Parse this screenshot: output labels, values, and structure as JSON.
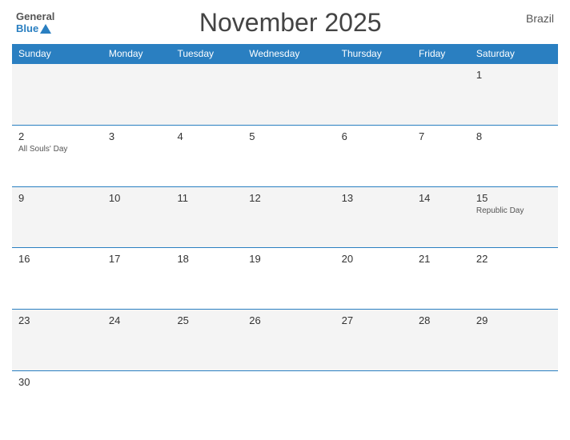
{
  "logo": {
    "general": "General",
    "blue": "Blue"
  },
  "title": "November 2025",
  "country": "Brazil",
  "days_header": [
    "Sunday",
    "Monday",
    "Tuesday",
    "Wednesday",
    "Thursday",
    "Friday",
    "Saturday"
  ],
  "weeks": [
    [
      {
        "day": "",
        "holiday": ""
      },
      {
        "day": "",
        "holiday": ""
      },
      {
        "day": "",
        "holiday": ""
      },
      {
        "day": "",
        "holiday": ""
      },
      {
        "day": "",
        "holiday": ""
      },
      {
        "day": "",
        "holiday": ""
      },
      {
        "day": "1",
        "holiday": ""
      }
    ],
    [
      {
        "day": "2",
        "holiday": "All Souls' Day"
      },
      {
        "day": "3",
        "holiday": ""
      },
      {
        "day": "4",
        "holiday": ""
      },
      {
        "day": "5",
        "holiday": ""
      },
      {
        "day": "6",
        "holiday": ""
      },
      {
        "day": "7",
        "holiday": ""
      },
      {
        "day": "8",
        "holiday": ""
      }
    ],
    [
      {
        "day": "9",
        "holiday": ""
      },
      {
        "day": "10",
        "holiday": ""
      },
      {
        "day": "11",
        "holiday": ""
      },
      {
        "day": "12",
        "holiday": ""
      },
      {
        "day": "13",
        "holiday": ""
      },
      {
        "day": "14",
        "holiday": ""
      },
      {
        "day": "15",
        "holiday": "Republic Day"
      }
    ],
    [
      {
        "day": "16",
        "holiday": ""
      },
      {
        "day": "17",
        "holiday": ""
      },
      {
        "day": "18",
        "holiday": ""
      },
      {
        "day": "19",
        "holiday": ""
      },
      {
        "day": "20",
        "holiday": ""
      },
      {
        "day": "21",
        "holiday": ""
      },
      {
        "day": "22",
        "holiday": ""
      }
    ],
    [
      {
        "day": "23",
        "holiday": ""
      },
      {
        "day": "24",
        "holiday": ""
      },
      {
        "day": "25",
        "holiday": ""
      },
      {
        "day": "26",
        "holiday": ""
      },
      {
        "day": "27",
        "holiday": ""
      },
      {
        "day": "28",
        "holiday": ""
      },
      {
        "day": "29",
        "holiday": ""
      }
    ],
    [
      {
        "day": "30",
        "holiday": ""
      },
      {
        "day": "",
        "holiday": ""
      },
      {
        "day": "",
        "holiday": ""
      },
      {
        "day": "",
        "holiday": ""
      },
      {
        "day": "",
        "holiday": ""
      },
      {
        "day": "",
        "holiday": ""
      },
      {
        "day": "",
        "holiday": ""
      }
    ]
  ]
}
